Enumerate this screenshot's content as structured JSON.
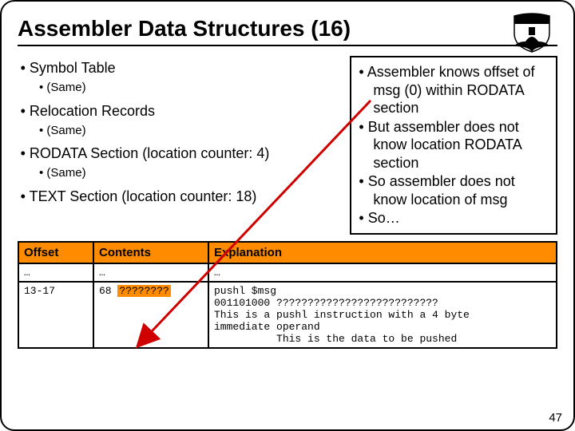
{
  "title": "Assembler Data Structures (16)",
  "left": {
    "symbolTable": "Symbol Table",
    "symbolSame": "(Same)",
    "reloc": "Relocation Records",
    "relocSame": "(Same)",
    "rodata": "RODATA Section (location counter: 4)",
    "rodataSame": "(Same)",
    "text": "TEXT Section (location counter: 18)"
  },
  "right": {
    "b1": "Assembler knows offset of msg (0) within RODATA section",
    "b2": "But assembler does not know location RODATA section",
    "b3": "So assembler does not know location of msg",
    "b4": "So…"
  },
  "table": {
    "h1": "Offset",
    "h2": "Contents",
    "h3": "Explanation",
    "r1c1": "…",
    "r1c2": "…",
    "r1c3": "…",
    "r2c1": "13-17",
    "r2c2a": "68 ",
    "r2c2b": "????????",
    "r2c3": "pushl $msg\n001101000 ??????????????????????????\nThis is a pushl instruction with a 4 byte\nimmediate operand\n          This is the data to be pushed"
  },
  "pagenum": "47"
}
